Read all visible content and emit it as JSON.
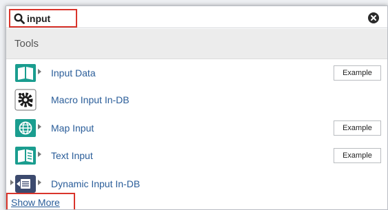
{
  "search": {
    "value": "input",
    "placeholder": ""
  },
  "section": {
    "title": "Tools"
  },
  "tools": [
    {
      "label": "Input Data",
      "icon": "book-open-icon",
      "example_label": "Example"
    },
    {
      "label": "Macro Input In-DB",
      "icon": "gear-icon",
      "example_label": ""
    },
    {
      "label": "Map Input",
      "icon": "globe-icon",
      "example_label": "Example"
    },
    {
      "label": "Text Input",
      "icon": "book-text-icon",
      "example_label": "Example"
    },
    {
      "label": "Dynamic Input In-DB",
      "icon": "database-input-icon",
      "example_label": ""
    }
  ],
  "footer": {
    "show_more_label": "Show More"
  },
  "colors": {
    "accent_green": "#1a9d8f",
    "link_blue": "#2a5d99",
    "highlight_red": "#d9342b",
    "indb_navy": "#3c4a6e"
  }
}
